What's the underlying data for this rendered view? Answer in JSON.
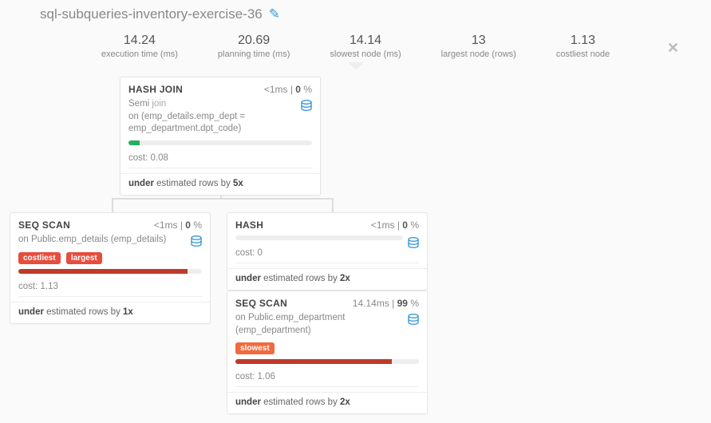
{
  "title": "sql-subqueries-inventory-exercise-36",
  "stats": {
    "exec": {
      "val": "14.24",
      "lbl": "execution time (ms)"
    },
    "plan": {
      "val": "20.69",
      "lbl": "planning time (ms)"
    },
    "slow": {
      "val": "14.14",
      "lbl": "slowest node (ms)"
    },
    "large": {
      "val": "13",
      "lbl": "largest node (rows)"
    },
    "cost": {
      "val": "1.13",
      "lbl": "costliest node"
    }
  },
  "nodes": {
    "hashjoin": {
      "op": "HASH JOIN",
      "time": "<1ms",
      "pct": "0",
      "desc_prefix": "Semi",
      "desc_kw": "join",
      "desc_on": "on (emp_details.emp_dept = emp_department.dpt_code)",
      "cost_label": "cost:",
      "cost": "0.08",
      "under_prefix": "under",
      "under_mid": " estimated rows by ",
      "under_x": "5x",
      "bar_pct": "6%",
      "bar_color": "green"
    },
    "seqscan1": {
      "op": "SEQ SCAN",
      "time": "<1ms",
      "pct": "0",
      "desc": "on Public.emp_details (emp_details)",
      "tag1": "costliest",
      "tag2": "largest",
      "cost_label": "cost:",
      "cost": "1.13",
      "under_prefix": "under",
      "under_mid": " estimated rows by ",
      "under_x": "1x",
      "bar_pct": "92%",
      "bar_color": "red"
    },
    "hash": {
      "op": "HASH",
      "time": "<1ms",
      "pct": "0",
      "cost_label": "cost:",
      "cost": "0",
      "under_prefix": "under",
      "under_mid": " estimated rows by ",
      "under_x": "2x",
      "bar_pct": "0%"
    },
    "seqscan2": {
      "op": "SEQ SCAN",
      "time": "14.14ms",
      "pct": "99",
      "desc": "on Public.emp_department (emp_department)",
      "tag": "slowest",
      "cost_label": "cost:",
      "cost": "1.06",
      "under_prefix": "under",
      "under_mid": " estimated rows by ",
      "under_x": "2x",
      "bar_pct": "85%",
      "bar_color": "red"
    }
  },
  "glyphs": {
    "pencil": "✎",
    "close": "✕"
  }
}
